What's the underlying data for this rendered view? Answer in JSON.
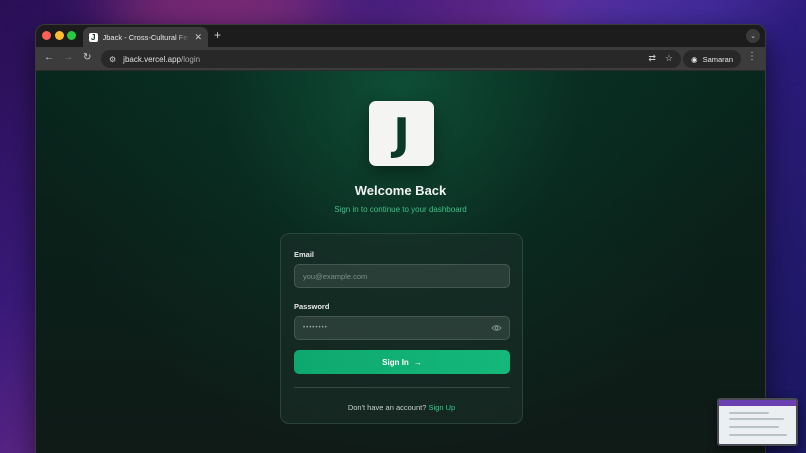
{
  "browser": {
    "tab_title": "Jback - Cross-Cultural Feedback",
    "tab_favicon_letter": "J",
    "url_domain": "jback.vercel.app",
    "url_path": "/login",
    "profile_name": "Samaran"
  },
  "login": {
    "logo_letter": "J",
    "title": "Welcome Back",
    "subtitle": "Sign in to continue to your dashboard",
    "email_label": "Email",
    "email_placeholder": "you@example.com",
    "password_label": "Password",
    "password_masked": "••••••••",
    "signin_label": "Sign In",
    "signin_arrow": "→",
    "no_account_text": "Don't have an account?",
    "signup_link": "Sign Up"
  },
  "colors": {
    "accent_green": "#14b87a",
    "subtitle_green": "#3fbf8a",
    "link_green": "#2ccf8e"
  },
  "icons": [
    "close-icon",
    "plus-icon",
    "back-icon",
    "forward-icon",
    "reload-icon",
    "site-settings-icon",
    "translate-icon",
    "star-icon",
    "incognito-icon",
    "kebab-menu-icon",
    "eye-icon",
    "arrow-right-icon"
  ]
}
